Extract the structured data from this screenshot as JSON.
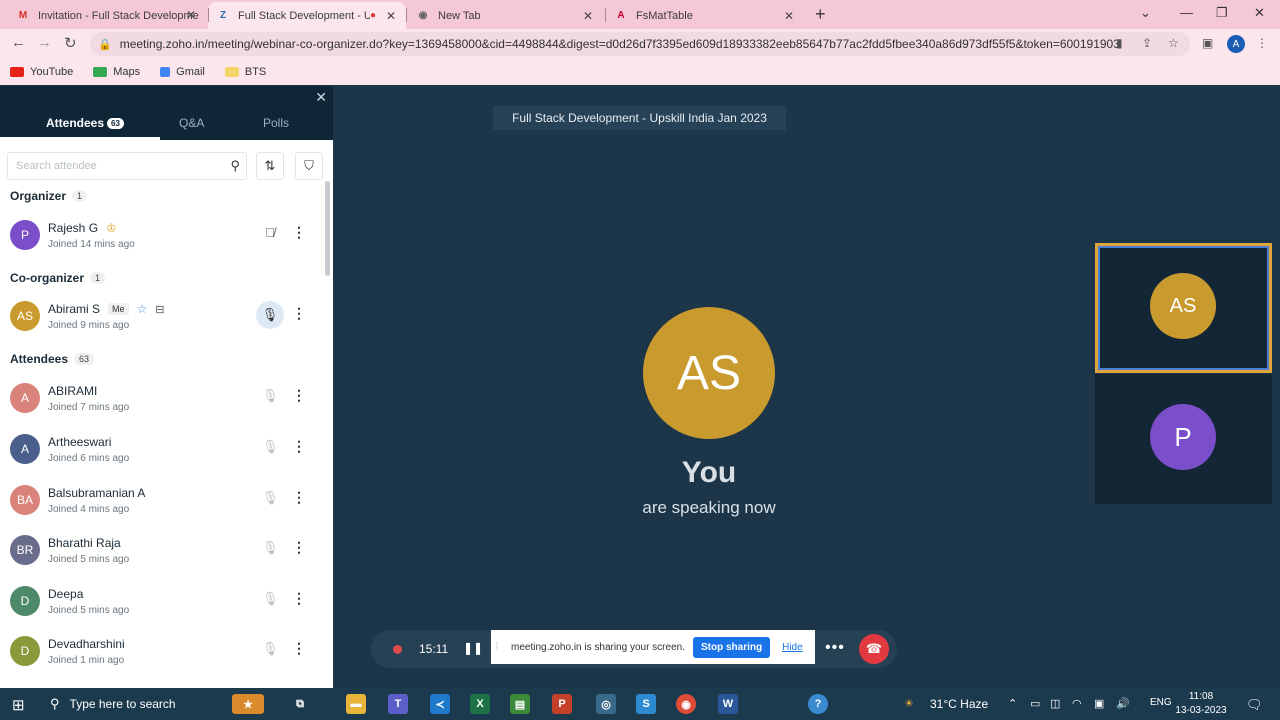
{
  "browser": {
    "tabs": [
      {
        "title": "Invitation - Full Stack Developme",
        "fav": "M",
        "fav_color": "#d93025"
      },
      {
        "title": "Full Stack Development - Up",
        "fav": "Z",
        "fav_color": "#2b6cb0"
      },
      {
        "title": "New Tab",
        "fav": "◉",
        "fav_color": "#5f6368"
      },
      {
        "title": "FsMatTable",
        "fav": "A",
        "fav_color": "#c3002f"
      }
    ],
    "url": "meeting.zoho.in/meeting/webinar-co-organizer.do?key=1369458000&cid=4498844&digest=d0d26d7f3395ed609d18933382eeb85647b77ac2fdd5fbee340a86d973df55f5&token=600191903...",
    "profile_initial": "A",
    "bookmarks": [
      "YouTube",
      "Maps",
      "Gmail",
      "BTS"
    ]
  },
  "panel": {
    "tabs": {
      "attendees": "Attendees",
      "attendees_count": "63",
      "qa": "Q&A",
      "polls": "Polls"
    },
    "search_placeholder": "Search attendee",
    "organizer_label": "Organizer",
    "organizer_count": "1",
    "coorganizer_label": "Co-organizer",
    "coorganizer_count": "1",
    "attendees_label": "Attendees",
    "attendees_count": "63",
    "organizer": {
      "initial": "P",
      "name": "Rajesh G",
      "joined": "Joined 14 mins ago",
      "color": "#7b4fc9"
    },
    "coorganizer": {
      "initial": "AS",
      "name": "Abirami S",
      "me": "Me",
      "joined": "Joined 9 mins ago",
      "color": "#c99a2e"
    },
    "attendees": [
      {
        "initial": "A",
        "name": "ABIRAMI",
        "joined": "Joined 7 mins ago",
        "color": "#d9837b"
      },
      {
        "initial": "A",
        "name": "Artheeswari",
        "joined": "Joined 6 mins ago",
        "color": "#4a5f8c"
      },
      {
        "initial": "BA",
        "name": "Balsubramanian A",
        "joined": "Joined 4 mins ago",
        "color": "#d9837b"
      },
      {
        "initial": "BR",
        "name": "Bharathi Raja",
        "joined": "Joined 5 mins ago",
        "color": "#6a6c8c"
      },
      {
        "initial": "D",
        "name": "Deepa",
        "joined": "Joined 5 mins ago",
        "color": "#4e8a6a"
      },
      {
        "initial": "D",
        "name": "Devadharshini",
        "joined": "Joined 1 min ago",
        "color": "#8a9a3a"
      }
    ]
  },
  "stage": {
    "meeting_title": "Full Stack Development - Upskill India Jan 2023",
    "speaker_initials": "AS",
    "you": "You",
    "speaking": "are speaking now",
    "thumb1": "AS",
    "thumb2": "P",
    "timer": "15:11",
    "share_text": "meeting.zoho.in is sharing your screen.",
    "stop_sharing": "Stop sharing",
    "hide": "Hide"
  },
  "taskbar": {
    "search": "Type here to search",
    "weather": "31°C  Haze",
    "lang": "ENG",
    "time": "11:08",
    "date": "13-03-2023"
  }
}
